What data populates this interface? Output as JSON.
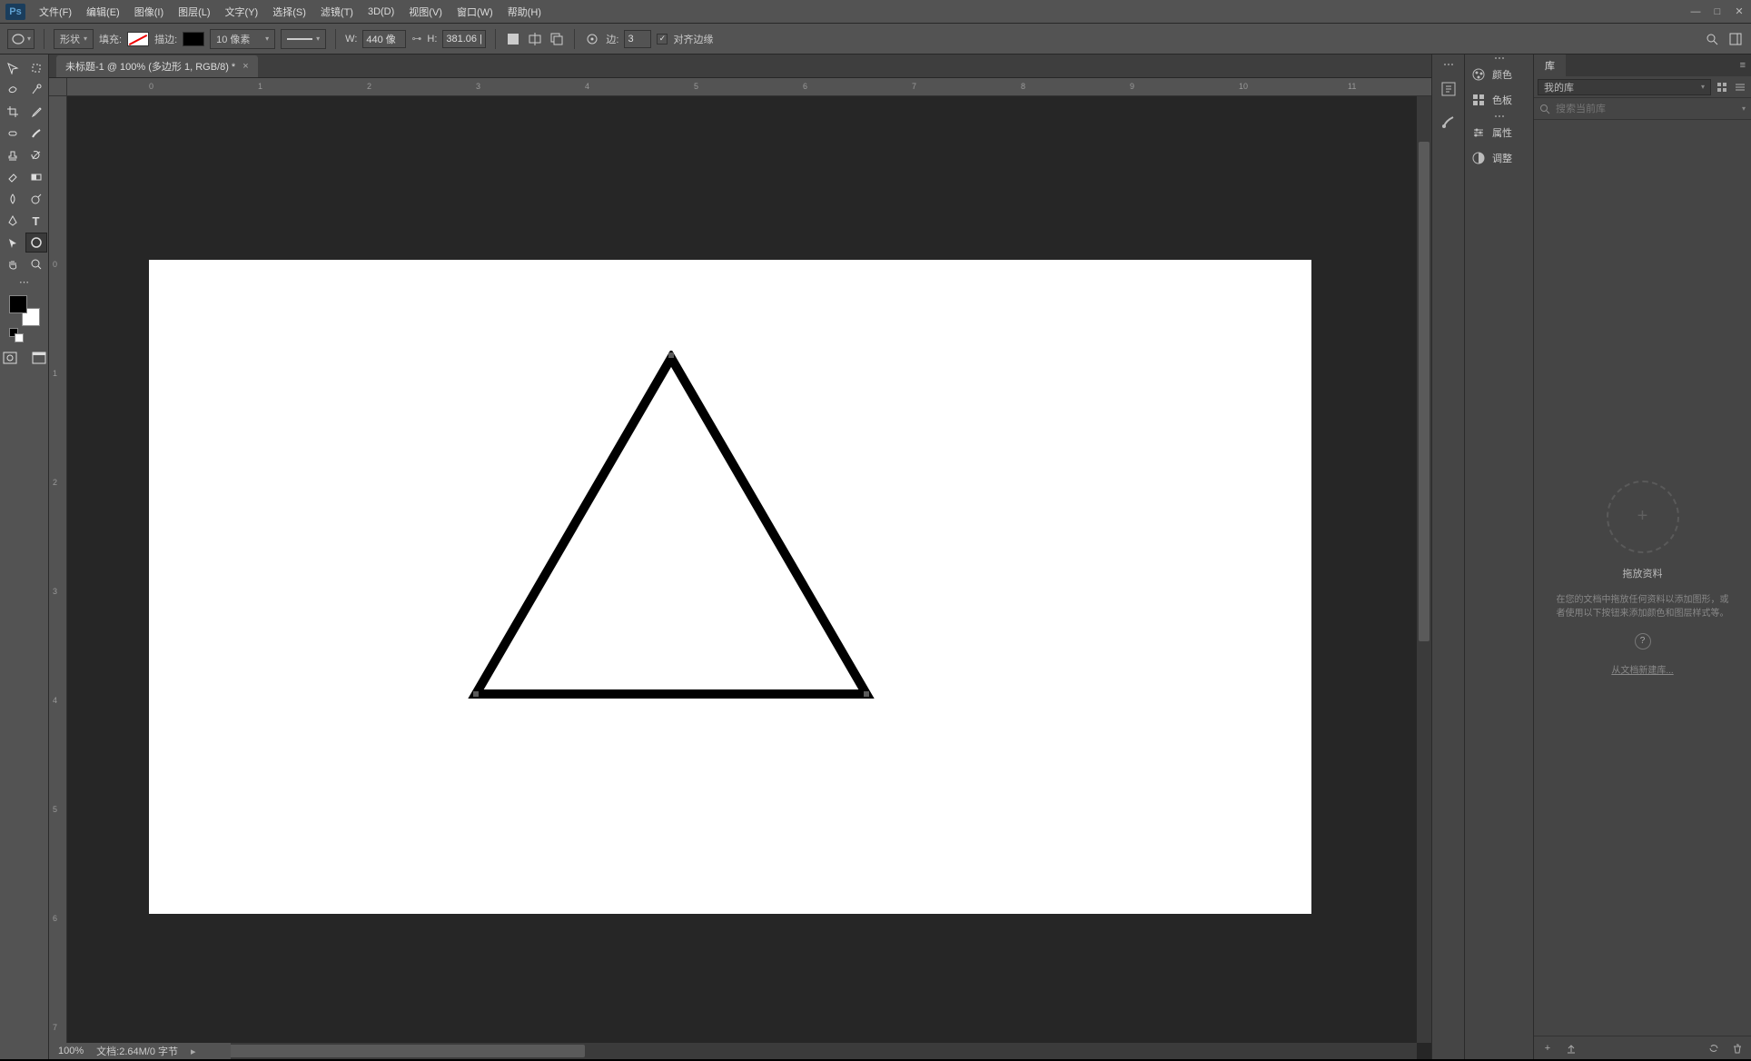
{
  "app": {
    "logo": "Ps"
  },
  "menu": {
    "file": "文件(F)",
    "edit": "编辑(E)",
    "image": "图像(I)",
    "layer": "图层(L)",
    "type": "文字(Y)",
    "select": "选择(S)",
    "filter": "滤镜(T)",
    "threeD": "3D(D)",
    "view": "视图(V)",
    "window": "窗口(W)",
    "help": "帮助(H)"
  },
  "optbar": {
    "mode_label": "形状",
    "fill_label": "填充:",
    "stroke_label": "描边:",
    "stroke_width": "10 像素",
    "w_label": "W:",
    "w_val": "440 像",
    "h_label": "H:",
    "h_val": "381.06 |",
    "sides_label": "边:",
    "sides_val": "3",
    "align_edges": "对齐边缘",
    "link_icon": "link"
  },
  "doc": {
    "tab_title": "未标题-1 @ 100% (多边形 1, RGB/8) *"
  },
  "ruler_h": [
    "0",
    "1",
    "2",
    "3",
    "4",
    "5",
    "6",
    "7",
    "8",
    "9",
    "10",
    "11"
  ],
  "ruler_v": [
    "0",
    "1",
    "2",
    "3",
    "4",
    "5",
    "6",
    "7"
  ],
  "status": {
    "zoom": "100%",
    "doc_info": "文档:2.64M/0 字节"
  },
  "panels": {
    "color": "颜色",
    "swatches": "色板",
    "properties": "属性",
    "adjustments": "调整"
  },
  "library": {
    "tab": "库",
    "dropdown": "我的库",
    "search_placeholder": "搜索当前库",
    "drop_title": "拖放资料",
    "drop_hint": "在您的文档中拖放任何资料以添加图形，或者使用以下按钮来添加颜色和图层样式等。",
    "new_link": "从文档新建库..."
  }
}
